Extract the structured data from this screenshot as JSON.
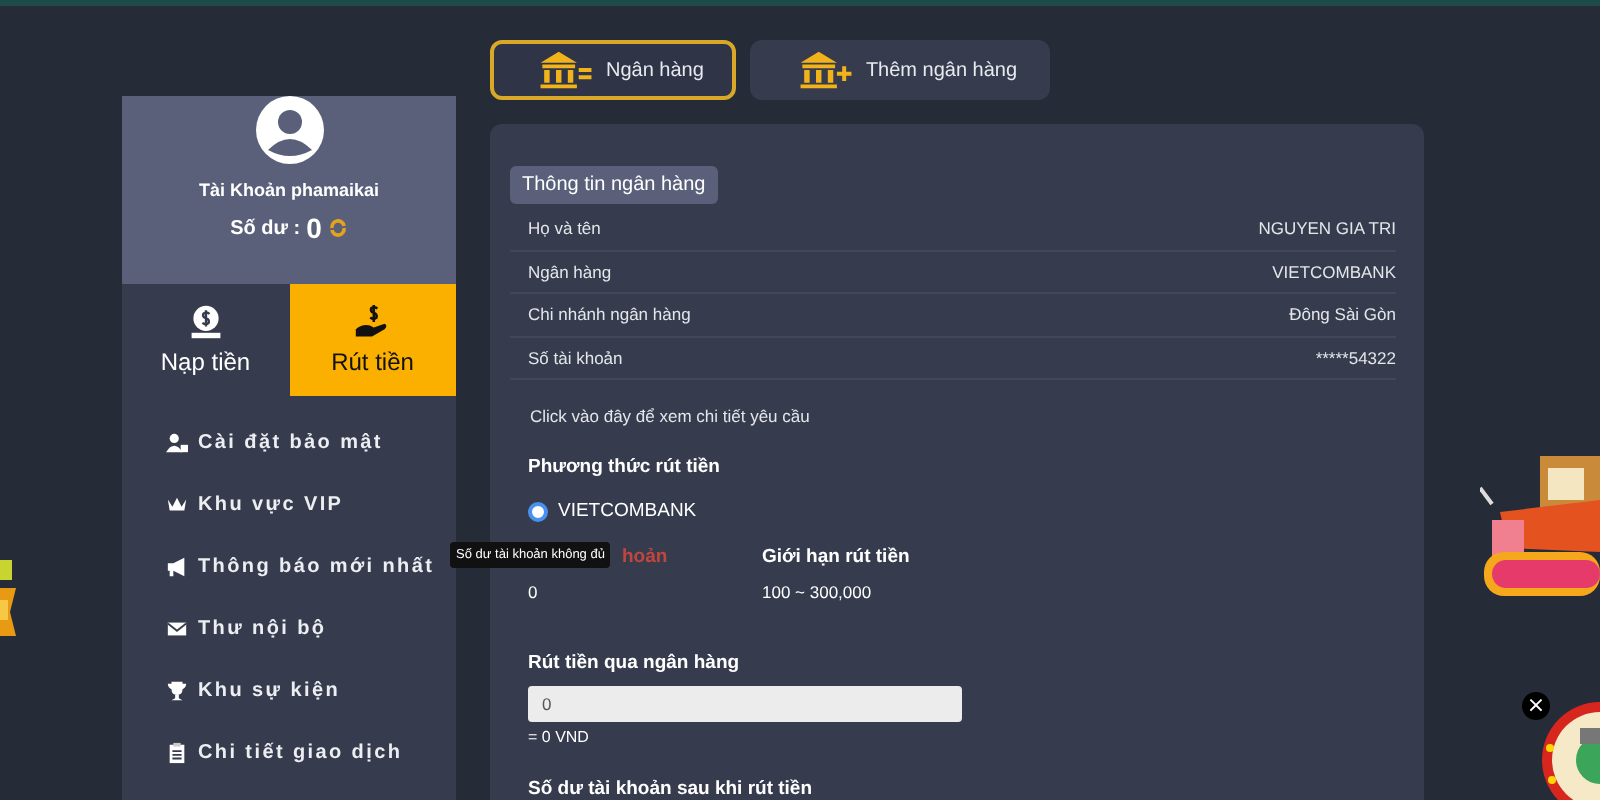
{
  "profile": {
    "account_label": "Tài Khoản",
    "username": "phamaikai",
    "balance_label": "Số dư :",
    "balance": "0"
  },
  "action_tabs": [
    {
      "label": "Nạp tiền",
      "selected": false
    },
    {
      "label": "Rút tiền",
      "selected": true
    }
  ],
  "menu": [
    {
      "label": "Cài đặt bảo mật"
    },
    {
      "label": "Khu vực VIP"
    },
    {
      "label": "Thông báo mới nhất"
    },
    {
      "label": "Thư nội bộ"
    },
    {
      "label": "Khu sự kiện"
    },
    {
      "label": "Chi tiết giao dịch"
    }
  ],
  "bank_tabs": [
    {
      "label": "Ngân hàng",
      "selected": true
    },
    {
      "label": "Thêm ngân hàng",
      "selected": false
    }
  ],
  "bank_info": {
    "title": "Thông tin ngân hàng",
    "rows": [
      {
        "label": "Họ và tên",
        "value": "NGUYEN GIA TRI"
      },
      {
        "label": "Ngân hàng",
        "value": "VIETCOMBANK"
      },
      {
        "label": "Chi nhánh ngân hàng",
        "value": "Đông Sài Gòn"
      },
      {
        "label": "Số tài khoản",
        "value": "*****54322"
      }
    ]
  },
  "details_link": "Click vào đây để xem chi tiết yêu cầu",
  "method": {
    "title": "Phương thức rút tiền",
    "options": [
      {
        "label": "VIETCOMBANK",
        "selected": true
      }
    ]
  },
  "stats": [
    {
      "label": "hoản",
      "value": "0",
      "warning": true
    },
    {
      "label": "Giới hạn rút tiền",
      "value": "100 ~ 300,000",
      "warning": false
    }
  ],
  "tooltip": "Số dư tài khoản không đủ",
  "amount": {
    "label": "Rút tiền qua ngân hàng",
    "value": "0",
    "converted": "= 0 VND"
  },
  "after_label": "Số dư tài khoản sau khi rút tiền",
  "close_button": "×"
}
